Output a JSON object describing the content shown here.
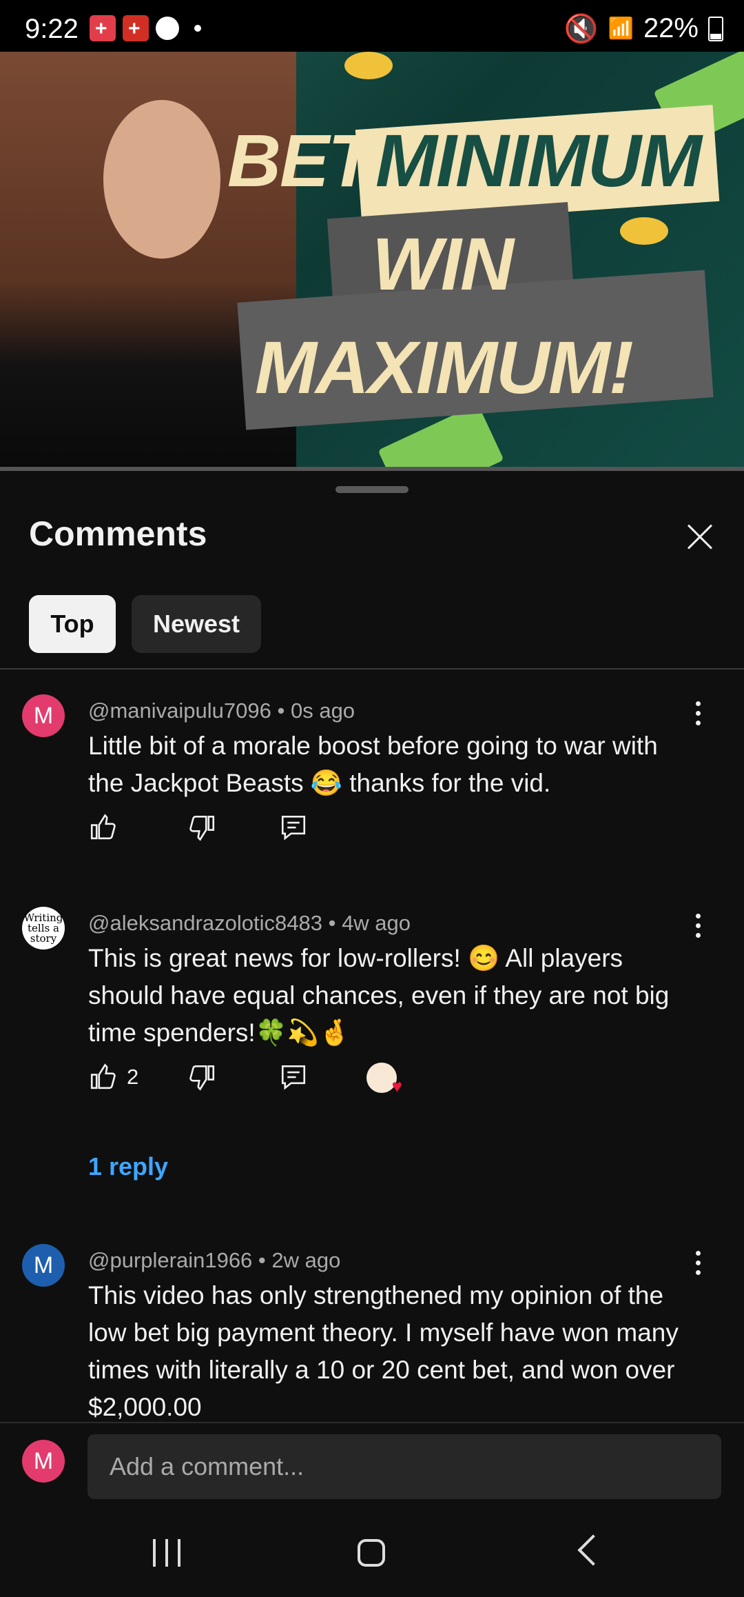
{
  "status_bar": {
    "time": "9:22",
    "battery": "22%"
  },
  "thumbnail": {
    "line1_a": "BET",
    "line1_b": "MINIMUM",
    "line2": "WIN",
    "line3": "MAXIMUM!"
  },
  "sheet": {
    "title": "Comments",
    "filters": [
      "Top",
      "Newest"
    ]
  },
  "comments": [
    {
      "avatar_letter": "M",
      "author": "@manivaipulu7096",
      "time": "0s ago",
      "text": "Little bit of a morale boost before going to war with the Jackpot Beasts 😂 thanks for the vid.",
      "likes": ""
    },
    {
      "avatar_letter": "Writing tells a story",
      "author": "@aleksandrazolotic8483",
      "time": "4w ago",
      "text": "This is great news for low-rollers! 😊 All players should have equal chances,  even if they are not big time spenders!🍀💫🤞",
      "likes": "2",
      "replies": "1 reply"
    },
    {
      "avatar_letter": "M",
      "author": "@purplerain1966",
      "time": "2w ago",
      "text": "This video has only strengthened my opinion of the low bet big payment theory.  I myself have won many times with literally a 10 or 20 cent bet, and won over $2,000.00",
      "likes": ""
    }
  ],
  "compose": {
    "avatar_letter": "M",
    "placeholder": "Add a comment..."
  }
}
